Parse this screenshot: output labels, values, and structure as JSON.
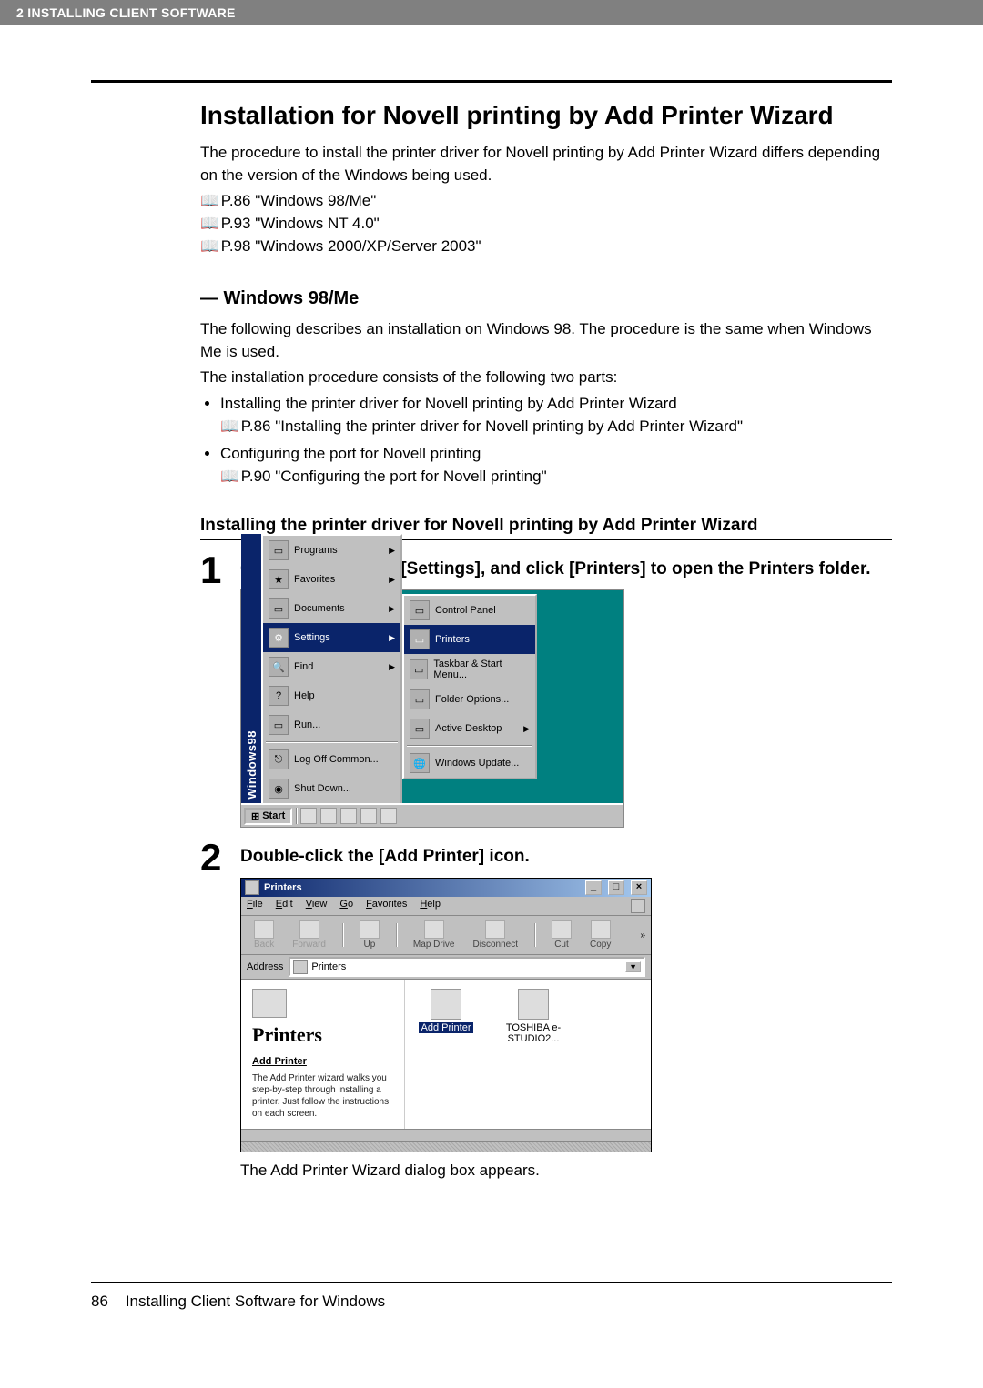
{
  "header": {
    "chapter_line": "2   INSTALLING CLIENT SOFTWARE"
  },
  "title": "Installation for Novell printing by Add Printer Wizard",
  "intro": "The procedure to install the printer driver for Novell printing by Add Printer Wizard differs depending on the version of the Windows being used.",
  "refs": {
    "r1": "P.86 \"Windows 98/Me\"",
    "r2": "P.93 \"Windows NT 4.0\"",
    "r3": "P.98 \"Windows 2000/XP/Server 2003\""
  },
  "icon_book": "📖",
  "subsection_title": "— Windows 98/Me",
  "sub_intro1": "The following describes an installation on Windows 98. The procedure is the same when Windows Me is used.",
  "sub_intro2": "The installation procedure consists of the following two parts:",
  "bullets": {
    "b1": "Installing the printer driver for Novell printing by Add Printer Wizard",
    "b1ref": "P.86 \"Installing the printer driver for Novell printing by Add Printer Wizard\"",
    "b2": "Configuring the port for Novell printing",
    "b2ref": "P.90 \"Configuring the port for Novell printing\""
  },
  "proc_title": "Installing the printer driver for Novell printing by Add Printer Wizard",
  "steps": {
    "s1_num": "1",
    "s1_text": "Click [Start], select [Settings], and click [Printers] to open the Printers folder.",
    "s2_num": "2",
    "s2_text": "Double-click the [Add Printer] icon.",
    "s2_after": "The Add Printer Wizard dialog box appears."
  },
  "shot1": {
    "brand": "Windows98",
    "items": {
      "programs": "Programs",
      "favorites": "Favorites",
      "documents": "Documents",
      "settings": "Settings",
      "find": "Find",
      "help": "Help",
      "run": "Run...",
      "logoff": "Log Off Common...",
      "shutdown": "Shut Down..."
    },
    "submenu": {
      "control_panel": "Control Panel",
      "printers": "Printers",
      "taskbar": "Taskbar & Start Menu...",
      "folder_options": "Folder Options...",
      "active_desktop": "Active Desktop",
      "windows_update": "Windows Update..."
    },
    "start": "Start"
  },
  "shot2": {
    "title": "Printers",
    "menu": {
      "file": "File",
      "edit": "Edit",
      "view": "View",
      "go": "Go",
      "favorites": "Favorites",
      "help": "Help"
    },
    "tool": {
      "back": "Back",
      "forward": "Forward",
      "up": "Up",
      "map": "Map Drive",
      "disconnect": "Disconnect",
      "cut": "Cut",
      "copy": "Copy"
    },
    "address_label": "Address",
    "address_value": "Printers",
    "left_title": "Printers",
    "sel_name": "Add Printer",
    "desc": "The Add Printer wizard walks you step-by-step through installing a printer. Just follow the instructions on each screen.",
    "icon_add": "Add Printer",
    "icon_toshiba": "TOSHIBA e-STUDIO2..."
  },
  "footer": {
    "page_num": "86",
    "section": "Installing Client Software for Windows"
  }
}
